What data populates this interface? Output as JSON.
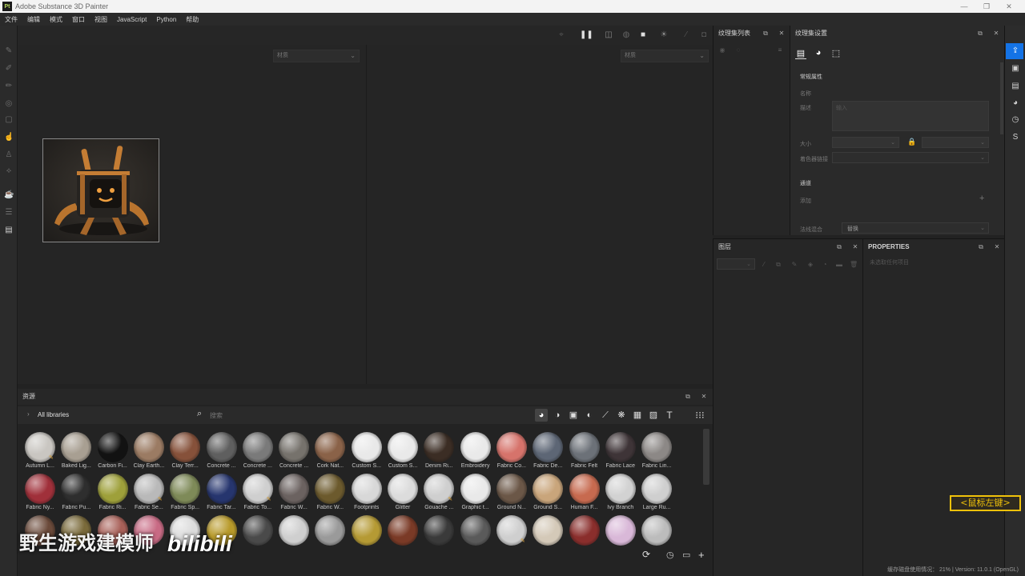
{
  "window": {
    "title": "Adobe Substance 3D Painter",
    "logo_text": "Pt"
  },
  "window_controls": [
    "—",
    "❐",
    "✕"
  ],
  "menu": [
    "文件",
    "编辑",
    "模式",
    "窗口",
    "视图",
    "JavaScript",
    "Python",
    "帮助"
  ],
  "left_tools": [
    "paint-brush-icon",
    "eraser-icon",
    "projection-icon",
    "geometry-mask-icon",
    "clone-icon",
    "smudge-icon",
    "picker-icon",
    "polygon-fill-icon",
    "bake-icon",
    "clipboard-icon",
    "document-icon"
  ],
  "viewport": {
    "dropdown_left": "材质",
    "dropdown_right": "材质",
    "top_icons": [
      "magnet-icon",
      "pause-icon",
      "split-view-icon",
      "sphere-icon",
      "camera-icon",
      "light-icon",
      "brush-icon",
      "screenshot-icon"
    ]
  },
  "assets": {
    "title": "资源",
    "library": "All libraries",
    "search_placeholder": "搜索",
    "filter_icons": [
      "material-icon",
      "smart-material-icon",
      "mask-icon",
      "filter-icon",
      "brush-icon",
      "pattern-icon",
      "texture-icon",
      "image-icon",
      "text-icon"
    ],
    "rows": [
      [
        {
          "label": "Autumn L...",
          "color": "#c9c6c1",
          "brush": true
        },
        {
          "label": "Baked Lig...",
          "color": "#a89f92",
          "brush": false
        },
        {
          "label": "Carbon Fi...",
          "color": "#121212",
          "brush": false
        },
        {
          "label": "Clay Earth...",
          "color": "#9b7b63",
          "brush": false
        },
        {
          "label": "Clay Terr...",
          "color": "#86513a",
          "brush": false
        },
        {
          "label": "Concrete ...",
          "color": "#5f5f5f",
          "brush": false
        },
        {
          "label": "Concrete ...",
          "color": "#7a7a7a",
          "brush": false
        },
        {
          "label": "Concrete ...",
          "color": "#76726c",
          "brush": false
        },
        {
          "label": "Cork Nat...",
          "color": "#8a6248",
          "brush": false
        },
        {
          "label": "Custom S...",
          "color": "#e9e9e9",
          "brush": false
        },
        {
          "label": "Custom S...",
          "color": "#e9e9e9",
          "brush": false
        },
        {
          "label": "Denim Ri...",
          "color": "#3b2d24",
          "brush": false
        },
        {
          "label": "Embroidery",
          "color": "#e9e9e9",
          "brush": false
        },
        {
          "label": "Fabric Co...",
          "color": "#d6736b",
          "brush": false
        },
        {
          "label": "Fabric De...",
          "color": "#5d6675",
          "brush": false
        },
        {
          "label": "Fabric Felt",
          "color": "#6c7178",
          "brush": false
        },
        {
          "label": "Fabric Lace",
          "color": "#3e3437",
          "brush": false
        },
        {
          "label": "Fabric Lin...",
          "color": "#8c8886",
          "brush": false
        }
      ],
      [
        {
          "label": "Fabric Ny...",
          "color": "#a0303a",
          "brush": false
        },
        {
          "label": "Fabric Pu...",
          "color": "#2e2e2e",
          "brush": false
        },
        {
          "label": "Fabric Ri...",
          "color": "#9ea03a",
          "brush": false
        },
        {
          "label": "Fabric Se...",
          "color": "#b9b9b9",
          "brush": true
        },
        {
          "label": "Fabric Sp...",
          "color": "#7e8a58",
          "brush": false
        },
        {
          "label": "Fabric Tar...",
          "color": "#26356e",
          "brush": false
        },
        {
          "label": "Fabric To...",
          "color": "#cfcfcf",
          "brush": true
        },
        {
          "label": "Fabric W...",
          "color": "#6b6260",
          "brush": false
        },
        {
          "label": "Fabric W...",
          "color": "#6c5a2d",
          "brush": false
        },
        {
          "label": "Footprints",
          "color": "#d8d8d8",
          "brush": false
        },
        {
          "label": "Glitter",
          "color": "#dcdcdc",
          "brush": false
        },
        {
          "label": "Gouache ...",
          "color": "#cfcfcf",
          "brush": true
        },
        {
          "label": "Graphic t...",
          "color": "#e9e9e9",
          "brush": false
        },
        {
          "label": "Ground N...",
          "color": "#6b5747",
          "brush": false
        },
        {
          "label": "Ground S...",
          "color": "#c9a57b",
          "brush": false
        },
        {
          "label": "Human F...",
          "color": "#c76a4f",
          "brush": false
        },
        {
          "label": "Ivy Branch",
          "color": "#d2d2d2",
          "brush": false
        },
        {
          "label": "Large Ru...",
          "color": "#cfcfcf",
          "brush": false
        }
      ],
      [
        {
          "label": "",
          "color": "#6b4a3a",
          "brush": false
        },
        {
          "label": "",
          "color": "#7a6a3a",
          "brush": false
        },
        {
          "label": "",
          "color": "#a86058",
          "brush": false
        },
        {
          "label": "",
          "color": "#c86a84",
          "brush": false
        },
        {
          "label": "",
          "color": "#dcdcdc",
          "brush": false
        },
        {
          "label": "",
          "color": "#b89a2a",
          "brush": false
        },
        {
          "label": "",
          "color": "#4a4a4a",
          "brush": false
        },
        {
          "label": "",
          "color": "#cfcfcf",
          "brush": false
        },
        {
          "label": "",
          "color": "#9a9a9a",
          "brush": false
        },
        {
          "label": "",
          "color": "#b59a34",
          "brush": false
        },
        {
          "label": "",
          "color": "#7a3a26",
          "brush": false
        },
        {
          "label": "",
          "color": "#3a3a3a",
          "brush": false
        },
        {
          "label": "",
          "color": "#5a5a5a",
          "brush": false
        },
        {
          "label": "",
          "color": "#cfcfcf",
          "brush": true
        },
        {
          "label": "",
          "color": "#d4c9b8",
          "brush": false
        },
        {
          "label": "",
          "color": "#8a2e2c",
          "brush": false
        },
        {
          "label": "",
          "color": "#d9b8d8",
          "brush": false
        },
        {
          "label": "",
          "color": "#bcbcbc",
          "brush": false
        }
      ]
    ]
  },
  "texture_set_list": {
    "title": "纹理集列表"
  },
  "texture_set_settings": {
    "title": "纹理集设置",
    "section_general": "常规属性",
    "name_label": "名称",
    "desc_label": "描述",
    "desc_placeholder": "输入",
    "size_label": "大小",
    "uv_label": "着色器链接",
    "channels_label": "通道",
    "add_label": "添加",
    "normal_label": "法线混合",
    "normal_value": "替换"
  },
  "layers": {
    "title": "图层"
  },
  "properties": {
    "title": "PROPERTIES",
    "empty_text": "未选取任何项目"
  },
  "status": {
    "text": "缓存磁盘使用情况：  21% | Version: 11.0.1 (OpenGL)"
  },
  "overlay": {
    "mouse_tag": "<鼠标左键>",
    "watermark": "野生游戏建模师",
    "bili": "bilibili"
  },
  "bottom_icons": [
    "refresh-icon",
    "clock-icon",
    "folder-icon",
    "add-icon"
  ],
  "right_sidebar_icons": [
    "export-icon",
    "display-icon",
    "shelf-icon",
    "viewer-icon",
    "history-icon",
    "substance-icon"
  ]
}
